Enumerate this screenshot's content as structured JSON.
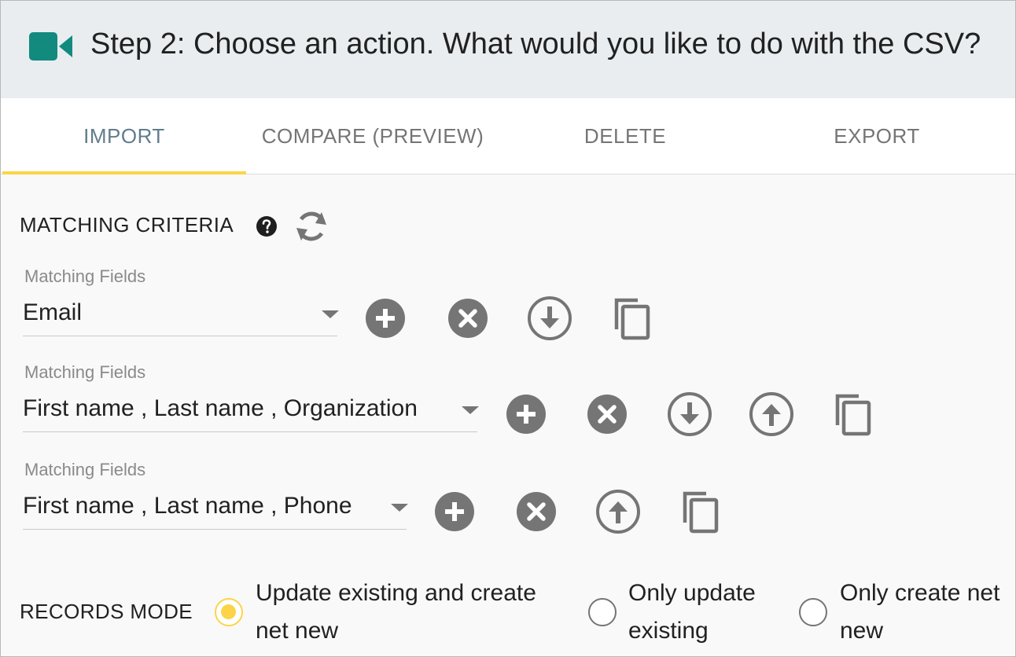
{
  "header": {
    "icon": "video-camera-icon",
    "title": "Step 2: Choose an action. What would you like to do with the CSV?",
    "icon_color": "#128a7e"
  },
  "tabs": [
    {
      "label": "IMPORT",
      "active": true
    },
    {
      "label": "COMPARE (PREVIEW)",
      "active": false
    },
    {
      "label": "DELETE",
      "active": false
    },
    {
      "label": "EXPORT",
      "active": false
    }
  ],
  "matching": {
    "title": "MATCHING CRITERIA",
    "help_icon": "question-circle-icon",
    "refresh_icon": "refresh-icon",
    "rows": [
      {
        "label": "Matching Fields",
        "value": "Email",
        "actions": [
          "add-icon",
          "remove-icon",
          "move-down-icon",
          "copy-icon"
        ]
      },
      {
        "label": "Matching Fields",
        "value": "First name , Last name , Organization",
        "actions": [
          "add-icon",
          "remove-icon",
          "move-down-icon",
          "move-up-icon",
          "copy-icon"
        ]
      },
      {
        "label": "Matching Fields",
        "value": "First name , Last name , Phone",
        "actions": [
          "add-icon",
          "remove-icon",
          "move-up-icon",
          "copy-icon"
        ]
      }
    ]
  },
  "records_mode": {
    "title": "RECORDS MODE",
    "options": [
      {
        "line1": "Update existing and create",
        "line2": "net new",
        "selected": true
      },
      {
        "line1": "Only update",
        "line2": "existing",
        "selected": false
      },
      {
        "line1": "Only create net",
        "line2": "new",
        "selected": false
      }
    ]
  },
  "colors": {
    "accent_yellow": "#fbd547",
    "active_tab_text": "#607d8b",
    "icon_gray": "#757575"
  }
}
